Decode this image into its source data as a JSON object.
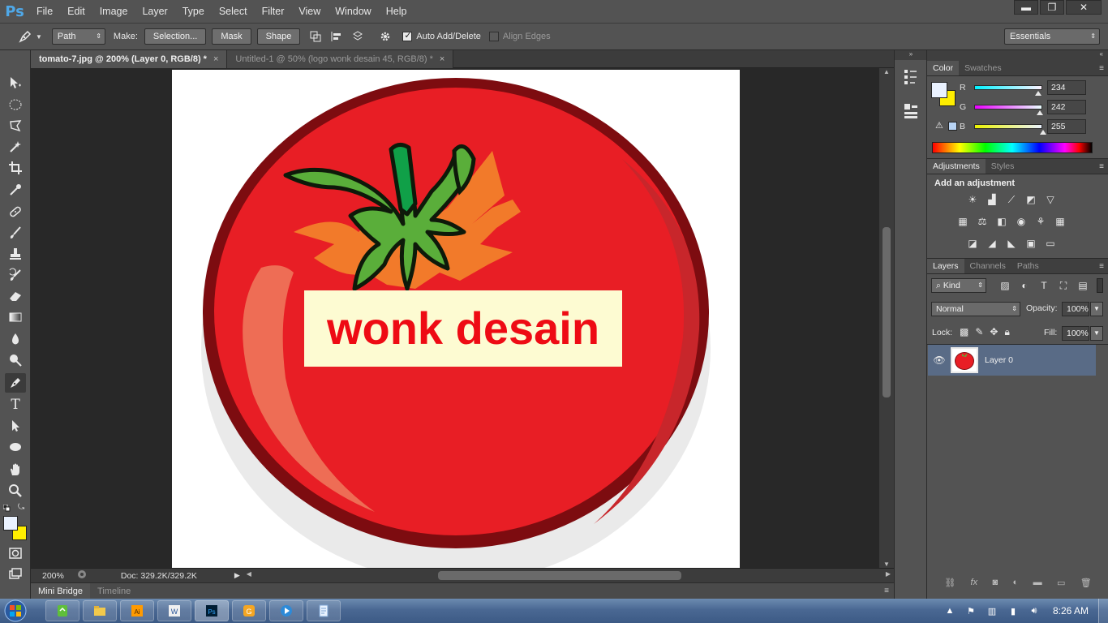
{
  "app": {
    "logo": "Ps",
    "name": "Adobe Photoshop"
  },
  "menu": [
    "File",
    "Edit",
    "Image",
    "Layer",
    "Type",
    "Select",
    "Filter",
    "View",
    "Window",
    "Help"
  ],
  "window_controls": {
    "minimize": "▬",
    "restore": "❐",
    "close": "✕"
  },
  "options_bar": {
    "tool_mode": "Path",
    "make_label": "Make:",
    "selection_btn": "Selection...",
    "mask_btn": "Mask",
    "shape_btn": "Shape",
    "auto_add_delete": "Auto Add/Delete",
    "auto_add_delete_checked": true,
    "align_edges": "Align Edges",
    "align_edges_checked": false,
    "workspace": "Essentials"
  },
  "tabs": [
    {
      "label": "tomato-7.jpg @ 200% (Layer 0, RGB/8) *",
      "active": true
    },
    {
      "label": "Untitled-1 @ 50% (logo wonk desain 45, RGB/8) *",
      "active": false
    }
  ],
  "canvas": {
    "overlay_text": "wonk desain",
    "text_color": "#ee0b14",
    "box_color": "#fdfbd2"
  },
  "status": {
    "zoom": "200%",
    "doc": "Doc: 329.2K/329.2K"
  },
  "bottom_tabs": [
    {
      "label": "Mini Bridge",
      "active": true
    },
    {
      "label": "Timeline",
      "active": false
    }
  ],
  "color_panel": {
    "tabs": [
      {
        "label": "Color",
        "active": true
      },
      {
        "label": "Swatches",
        "active": false
      }
    ],
    "channels": [
      {
        "label": "R",
        "value": "234"
      },
      {
        "label": "G",
        "value": "242"
      },
      {
        "label": "B",
        "value": "255"
      }
    ],
    "foreground": "#eaf2ff",
    "background": "#ffee00"
  },
  "adjustments_panel": {
    "tabs": [
      {
        "label": "Adjustments",
        "active": true
      },
      {
        "label": "Styles",
        "active": false
      }
    ],
    "heading": "Add an adjustment"
  },
  "layers_panel": {
    "tabs": [
      {
        "label": "Layers",
        "active": true
      },
      {
        "label": "Channels",
        "active": false
      },
      {
        "label": "Paths",
        "active": false
      }
    ],
    "filter_kind": "Kind",
    "blend_mode": "Normal",
    "opacity_label": "Opacity:",
    "opacity": "100%",
    "lock_label": "Lock:",
    "fill_label": "Fill:",
    "fill": "100%",
    "layers": [
      {
        "name": "Layer 0",
        "visible": true
      }
    ]
  },
  "taskbar": {
    "clock": "8:26 AM"
  }
}
